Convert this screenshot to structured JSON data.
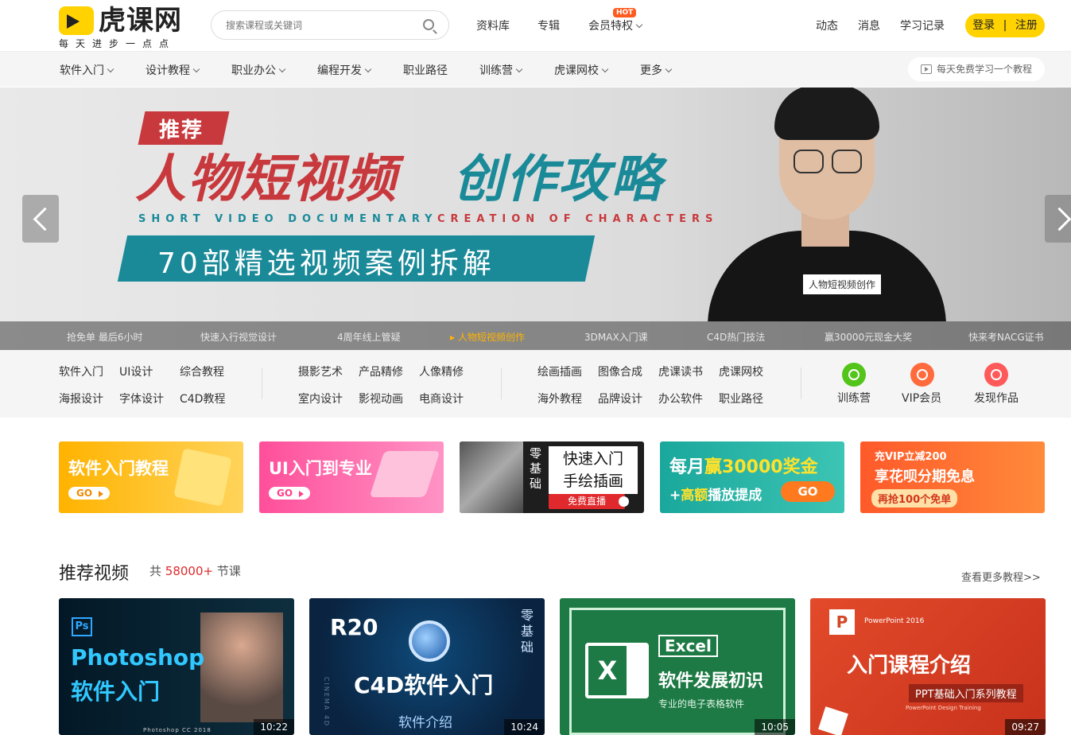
{
  "header": {
    "logo_name": "虎课网",
    "logo_slogan": "每天进步一点点",
    "search_placeholder": "搜索课程或关键词",
    "nav": [
      "资料库",
      "专辑",
      "会员特权"
    ],
    "hot_badge": "HOT",
    "right_nav": [
      "动态",
      "消息",
      "学习记录"
    ],
    "login": "登录",
    "register": "注册",
    "login_divider": "|"
  },
  "categories": [
    "软件入门",
    "设计教程",
    "职业办公",
    "编程开发",
    "职业路径",
    "训练营",
    "虎课网校",
    "更多"
  ],
  "free_course": "每天免费学习一个教程",
  "banner": {
    "tag": "推荐",
    "headline_a": "人物短视频",
    "headline_b": "创作攻略",
    "english_a": "SHORT VIDEO DOCUMENTARY",
    "english_b": "CREATION OF CHARACTERS",
    "strip": "70部精选视频案例拆解",
    "caption": "人物短视频创作",
    "slides": [
      "抢免单 最后6小时",
      "快速入行视觉设计",
      "4周年线上管疑",
      "人物短视频创作",
      "3DMAX入门课",
      "C4D热门技法",
      "赢30000元现金大奖",
      "快来考NACG证书"
    ],
    "active_slide": 3
  },
  "quick_links": {
    "group1": [
      [
        "软件入门",
        "UI设计",
        "综合教程"
      ],
      [
        "海报设计",
        "字体设计",
        "C4D教程"
      ]
    ],
    "group2": [
      [
        "摄影艺术",
        "产品精修",
        "人像精修"
      ],
      [
        "室内设计",
        "影视动画",
        "电商设计"
      ]
    ],
    "group3": [
      [
        "绘画插画",
        "图像合成",
        "虎课读书",
        "虎课网校"
      ],
      [
        "海外教程",
        "品牌设计",
        "办公软件",
        "职业路径"
      ]
    ],
    "features": [
      {
        "label": "训练营",
        "icon": "target-icon",
        "color": "#52c41a"
      },
      {
        "label": "VIP会员",
        "icon": "diamond-icon",
        "color": "#ff6b3d"
      },
      {
        "label": "发现作品",
        "icon": "image-icon",
        "color": "#ff5a5a"
      }
    ]
  },
  "promos": [
    {
      "title": "软件入门教程",
      "cta": "GO",
      "from": "#ffb300",
      "to": "#ffd35a",
      "cta_color": "#f08a00"
    },
    {
      "title": "UI入门到专业",
      "cta": "GO",
      "from": "#ff4f9a",
      "to": "#ff93c5",
      "cta_color": "#ff3f88"
    },
    {
      "title_line1": "快速入门",
      "title_line2": "手绘插画",
      "side": "零基础",
      "cta": "免费直播"
    },
    {
      "title_a": "每月",
      "title_b": "赢",
      "title_c": "30000奖金",
      "sub_a": "+",
      "sub_b": "高额",
      "sub_c": "播放提成",
      "cta": "GO"
    },
    {
      "line1": "充VIP立减200",
      "line2": "享花呗分期免息",
      "line3": "再抢100个免单"
    }
  ],
  "section": {
    "title": "推荐视频",
    "count_prefix": "共",
    "count": "58000+",
    "count_suffix": "节课",
    "more": "查看更多教程>>"
  },
  "videos": [
    {
      "badge": "Ps",
      "title1": "Photoshop",
      "title2": "软件入门",
      "foot": "Photoshop CC 2018",
      "duration": "10:22"
    },
    {
      "badge": "R20",
      "title": "C4D软件入门",
      "subtitle": "软件介绍",
      "side": "零基础",
      "side_en": "CINEMA 4D",
      "duration": "10:24"
    },
    {
      "badge": "Excel",
      "title": "软件发展初识",
      "subtitle": "专业的电子表格软件",
      "duration": "10:05"
    },
    {
      "app": "PowerPoint 2016",
      "title": "入门课程介绍",
      "subtitle": "PPT基础入门系列教程",
      "caption": "PowerPoint Design Training",
      "duration": "09:27"
    }
  ]
}
